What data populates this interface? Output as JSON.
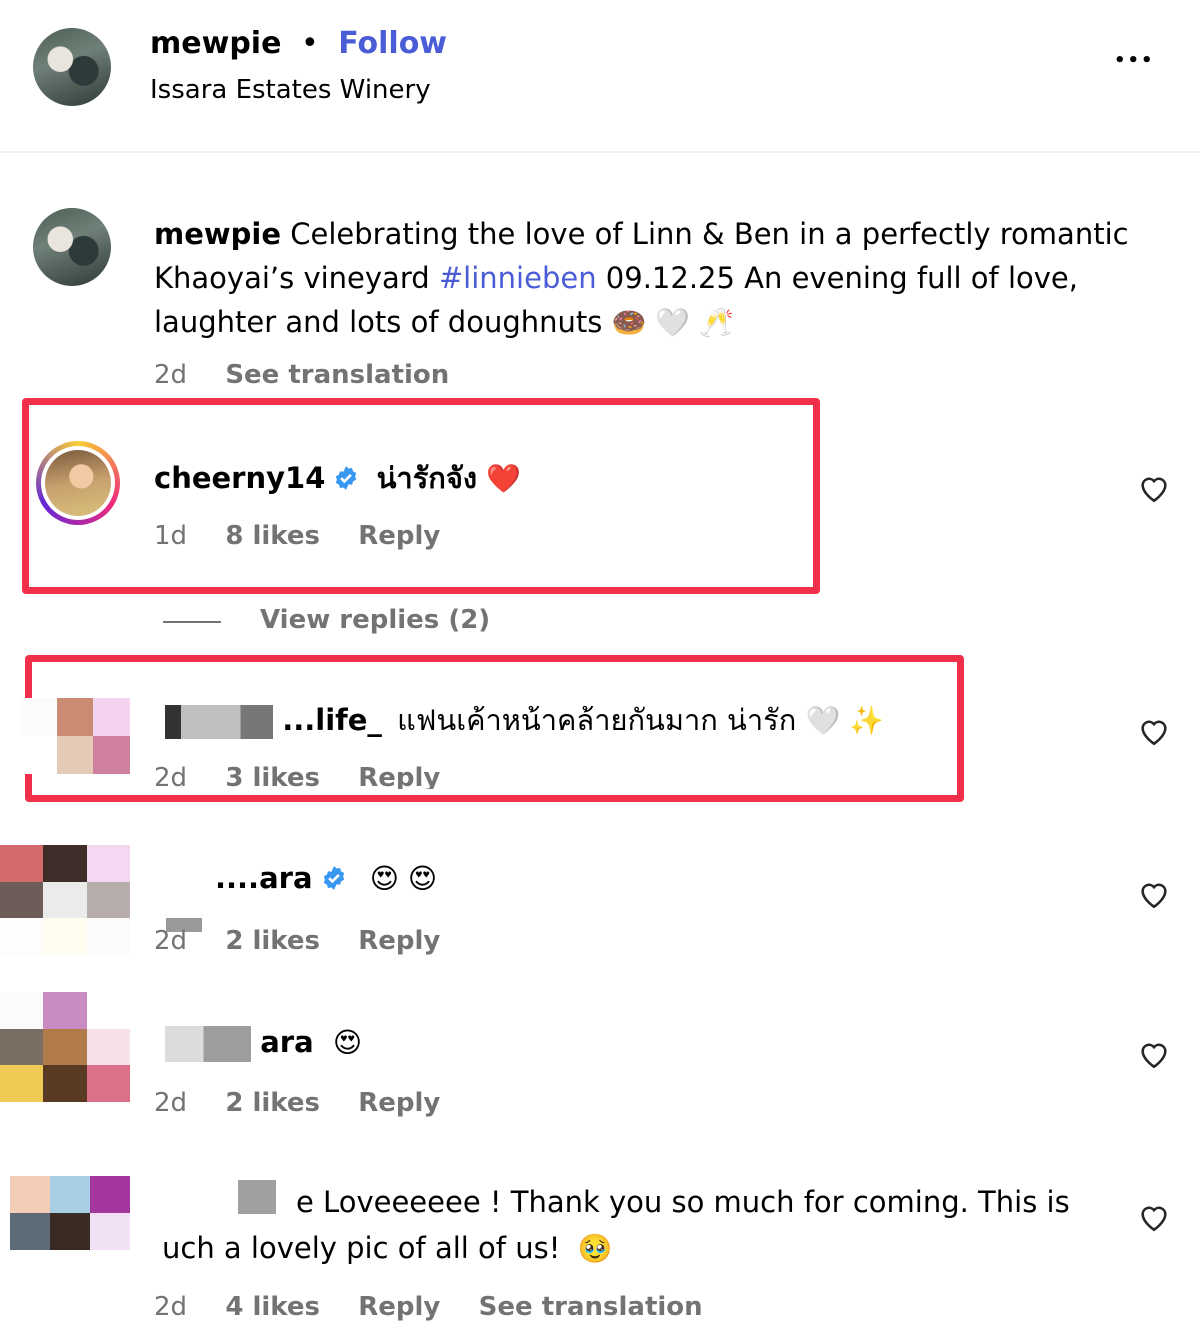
{
  "header": {
    "username": "mewpie",
    "dot": "•",
    "follow": "Follow",
    "location": "Issara Estates Winery",
    "more": "•••"
  },
  "caption": {
    "username": "mewpie",
    "text_before": "Celebrating the love of Linn & Ben in a perfectly romantic Khaoyai’s vineyard ",
    "hashtag": "#linnieben",
    "text_after": " 09.12.25 An evening full of love, laughter and lots of doughnuts",
    "emojis": "🍩 🤍 🥂",
    "time": "2d",
    "see_translation": "See translation"
  },
  "comments": [
    {
      "username": "cheerny14",
      "text": "น่ารักจัง",
      "emoji": "❤️",
      "time": "1d",
      "likes": "8 likes",
      "reply": "Reply",
      "view_replies": "View replies (2)"
    },
    {
      "username": "...life_",
      "text": "แฟนเค้าหน้าคล้ายกันมาก น่ารัก",
      "emoji": "🤍 ✨",
      "time": "2d",
      "likes": "3 likes",
      "reply": "Reply"
    },
    {
      "username": "....ara",
      "text": "",
      "emoji": "😍 😍",
      "time": "2d",
      "likes": "2 likes",
      "reply": "Reply"
    },
    {
      "username": "ara",
      "text": "",
      "emoji": "😍",
      "time": "2d",
      "likes": "2 likes",
      "reply": "Reply"
    },
    {
      "username": "",
      "text_line1": "e Loveeeeee ! Thank you so much for coming. This is",
      "text_line2": "uch a lovely pic of all of us!",
      "emoji": "🥹",
      "time": "2d",
      "likes": "4 likes",
      "reply": "Reply",
      "see_translation": "See translation"
    }
  ],
  "colors": {
    "link": "#4a5cd6",
    "verified": "#3897f0",
    "highlight": "#f0304a",
    "muted": "#737373"
  },
  "icons": {
    "like": "heart-icon",
    "verified": "verified-badge-icon",
    "more": "more-icon"
  }
}
